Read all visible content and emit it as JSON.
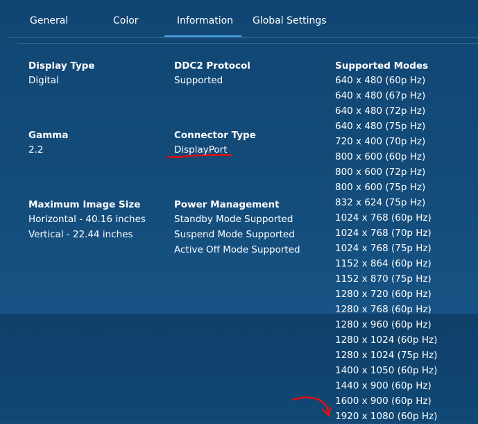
{
  "tabs": [
    {
      "label": "General"
    },
    {
      "label": "Color"
    },
    {
      "label": "Information"
    },
    {
      "label": "Global Settings"
    }
  ],
  "info": {
    "display_type": {
      "label": "Display Type",
      "value": "Digital"
    },
    "gamma": {
      "label": "Gamma",
      "value": "2.2"
    },
    "max_image_size": {
      "label": "Maximum Image Size",
      "horizontal": "Horizontal - 40.16 inches",
      "vertical": "Vertical - 22.44 inches"
    },
    "ddc2": {
      "label": "DDC2 Protocol",
      "value": "Supported"
    },
    "connector": {
      "label": "Connector Type",
      "value": "DisplayPort"
    },
    "power": {
      "label": "Power Management",
      "values": [
        "Standby Mode Supported",
        "Suspend Mode Supported",
        "Active Off Mode Supported"
      ]
    }
  },
  "supported_modes": {
    "label": "Supported Modes",
    "items": [
      "640 x 480 (60p Hz)",
      "640 x 480 (67p Hz)",
      "640 x 480 (72p Hz)",
      "640 x 480 (75p Hz)",
      "720 x 400 (70p Hz)",
      "800 x 600 (60p Hz)",
      "800 x 600 (72p Hz)",
      "800 x 600 (75p Hz)",
      "832 x 624 (75p Hz)",
      "1024 x 768 (60p Hz)",
      "1024 x 768 (70p Hz)",
      "1024 x 768 (75p Hz)",
      "1152 x 864 (60p Hz)",
      "1152 x 870 (75p Hz)",
      "1280 x 720 (60p Hz)",
      "1280 x 768 (60p Hz)",
      "1280 x 960 (60p Hz)",
      "1280 x 1024 (60p Hz)",
      "1280 x 1024 (75p Hz)",
      "1400 x 1050 (60p Hz)",
      "1440 x 900 (60p Hz)",
      "1600 x 900 (60p Hz)",
      "1920 x 1080 (60p Hz)"
    ]
  },
  "colors": {
    "background": "#134b79",
    "tab_underline": "#4aa3e8",
    "annotation_red": "#e01010",
    "text": "#ffffff"
  }
}
